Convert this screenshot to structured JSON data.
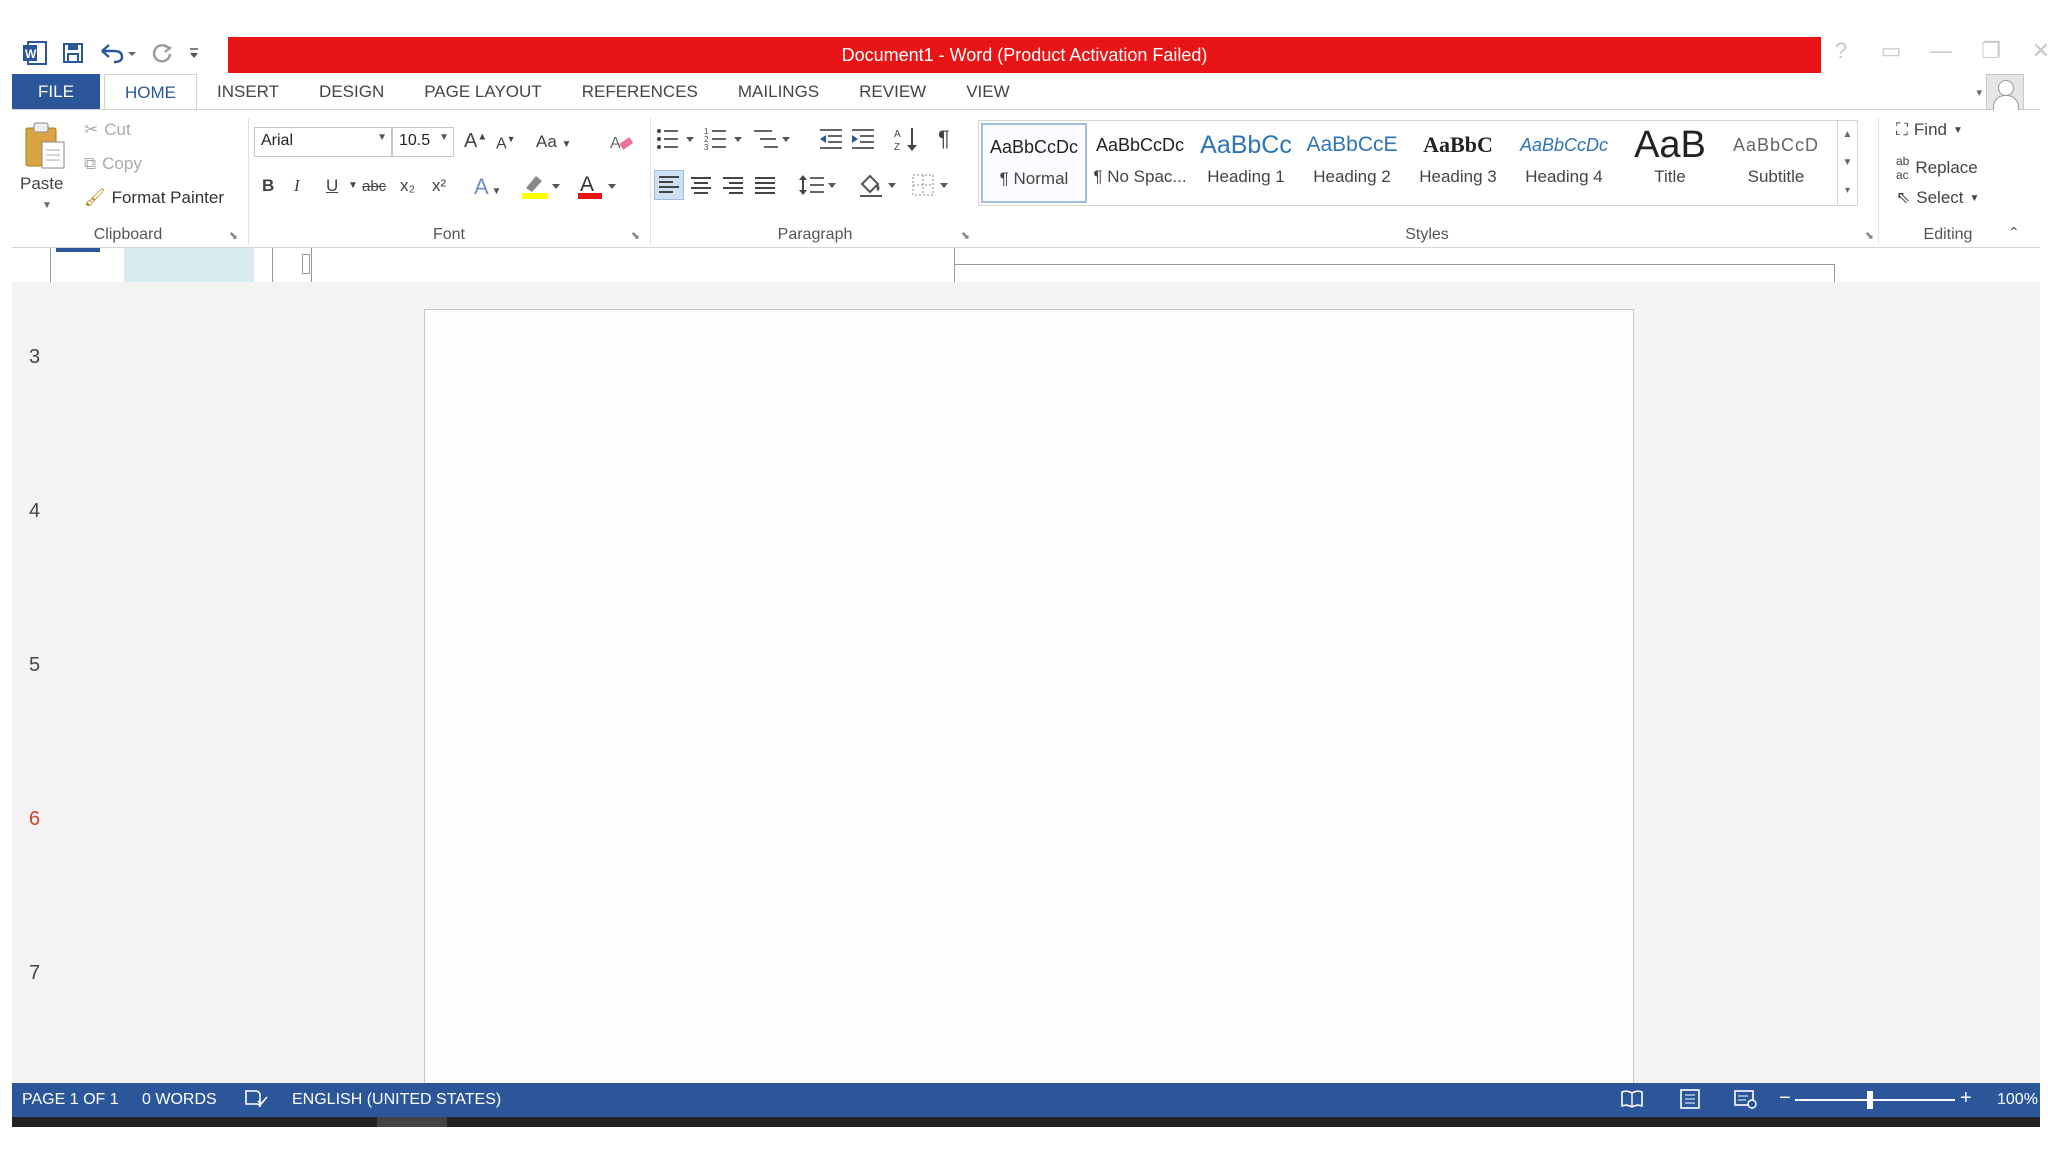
{
  "window": {
    "title": "Document1 -  Word (Product Activation Failed)",
    "controls": {
      "help": "?",
      "restore_ribbon": "▭",
      "minimize": "—",
      "maximize": "❐",
      "close": "✕"
    }
  },
  "quick_access": [
    "word-logo",
    "save",
    "undo",
    "redo",
    "customize"
  ],
  "tabs": [
    "FILE",
    "HOME",
    "INSERT",
    "DESIGN",
    "PAGE LAYOUT",
    "REFERENCES",
    "MAILINGS",
    "REVIEW",
    "VIEW"
  ],
  "ribbon": {
    "clipboard": {
      "label": "Clipboard",
      "paste": "Paste",
      "cut": "Cut",
      "copy": "Copy",
      "format_painter": "Format Painter"
    },
    "font": {
      "label": "Font",
      "font_name": "Arial",
      "font_size": "10.5",
      "grow": "A",
      "shrink": "A",
      "change_case": "Aa",
      "bold": "B",
      "italic": "I",
      "underline": "U",
      "strikethrough": "abc",
      "subscript": "x₂",
      "superscript": "x²",
      "text_effects": "A",
      "font_color": "A",
      "font_color_hex": "#e81416",
      "highlight_hex": "#ffff00"
    },
    "paragraph": {
      "label": "Paragraph",
      "show_marks": "¶"
    },
    "styles": {
      "label": "Styles",
      "items": [
        {
          "sample": "AaBbCcDc",
          "name": "¶ Normal"
        },
        {
          "sample": "AaBbCcDc",
          "name": "¶ No Spac..."
        },
        {
          "sample": "AaBbCc",
          "name": "Heading 1"
        },
        {
          "sample": "AaBbCcE",
          "name": "Heading 2"
        },
        {
          "sample": "AaBbC",
          "name": "Heading 3"
        },
        {
          "sample": "AaBbCcDc",
          "name": "Heading 4"
        },
        {
          "sample": "AaB",
          "name": "Title"
        },
        {
          "sample": "AaBbCcD",
          "name": "Subtitle"
        }
      ]
    },
    "editing": {
      "label": "Editing",
      "find": "Find",
      "replace": "Replace",
      "select": "Select"
    }
  },
  "document": {
    "line_numbers": [
      "3",
      "4",
      "5",
      "6",
      "7"
    ],
    "active_line": "6"
  },
  "status_bar": {
    "page": "PAGE 1 OF 1",
    "words": "0 WORDS",
    "language": "ENGLISH (UNITED STATES)",
    "zoom": "100%",
    "zoom_minus": "−",
    "zoom_plus": "+"
  },
  "colors": {
    "brand_blue": "#2b579a",
    "activation_red": "#e81416",
    "line_number_active": "#c8472a"
  }
}
